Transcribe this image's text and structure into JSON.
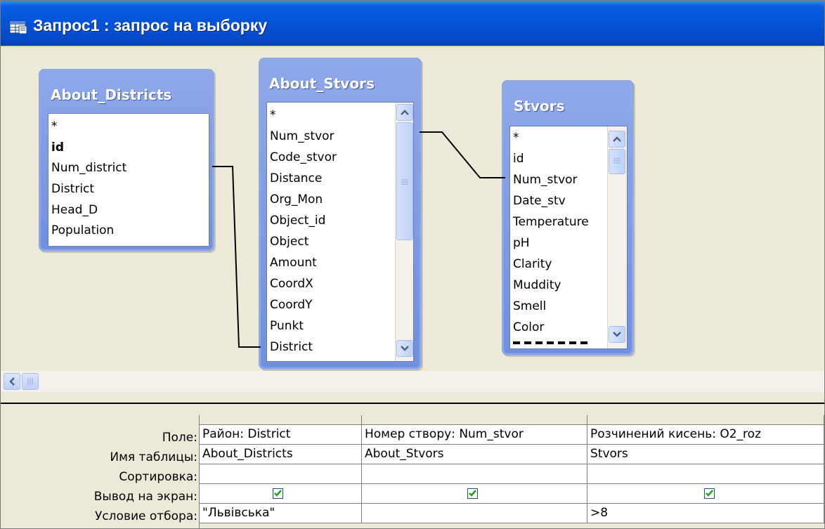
{
  "window": {
    "title": "Запрос1 : запрос на выборку"
  },
  "tables": [
    {
      "name": "About_Districts",
      "fields": [
        "*",
        "id",
        "Num_district",
        "District",
        "Head_D",
        "Population"
      ],
      "bold_fields": [
        "id"
      ]
    },
    {
      "name": "About_Stvors",
      "fields": [
        "*",
        "Num_stvor",
        "Code_stvor",
        "Distance",
        "Org_Mon",
        "Object_id",
        "Object",
        "Amount",
        "CoordX",
        "CoordY",
        "Punkt",
        "District"
      ]
    },
    {
      "name": "Stvors",
      "fields": [
        "*",
        "id",
        "Num_stvor",
        "Date_stv",
        "Temperature",
        "pH",
        "Clarity",
        "Muddity",
        "Smell",
        "Color"
      ]
    }
  ],
  "grid": {
    "row_labels": [
      "Поле:",
      "Имя таблицы:",
      "Сортировка:",
      "Вывод на экран:",
      "Условие отбора:"
    ],
    "columns": [
      {
        "field": "Район: District",
        "table": "About_Districts",
        "sort": "",
        "show": true,
        "criteria": "\"Львівська\""
      },
      {
        "field": "Номер створу: Num_stvor",
        "table": "About_Stvors",
        "sort": "",
        "show": true,
        "criteria": ""
      },
      {
        "field": "Розчинений кисень: O2_roz",
        "table": "Stvors",
        "sort": "",
        "show": true,
        "criteria": ">8"
      }
    ]
  },
  "colors": {
    "title_bar": "#0453d6",
    "table_header": "#7b98e3",
    "checkbox_check": "#21a121"
  }
}
